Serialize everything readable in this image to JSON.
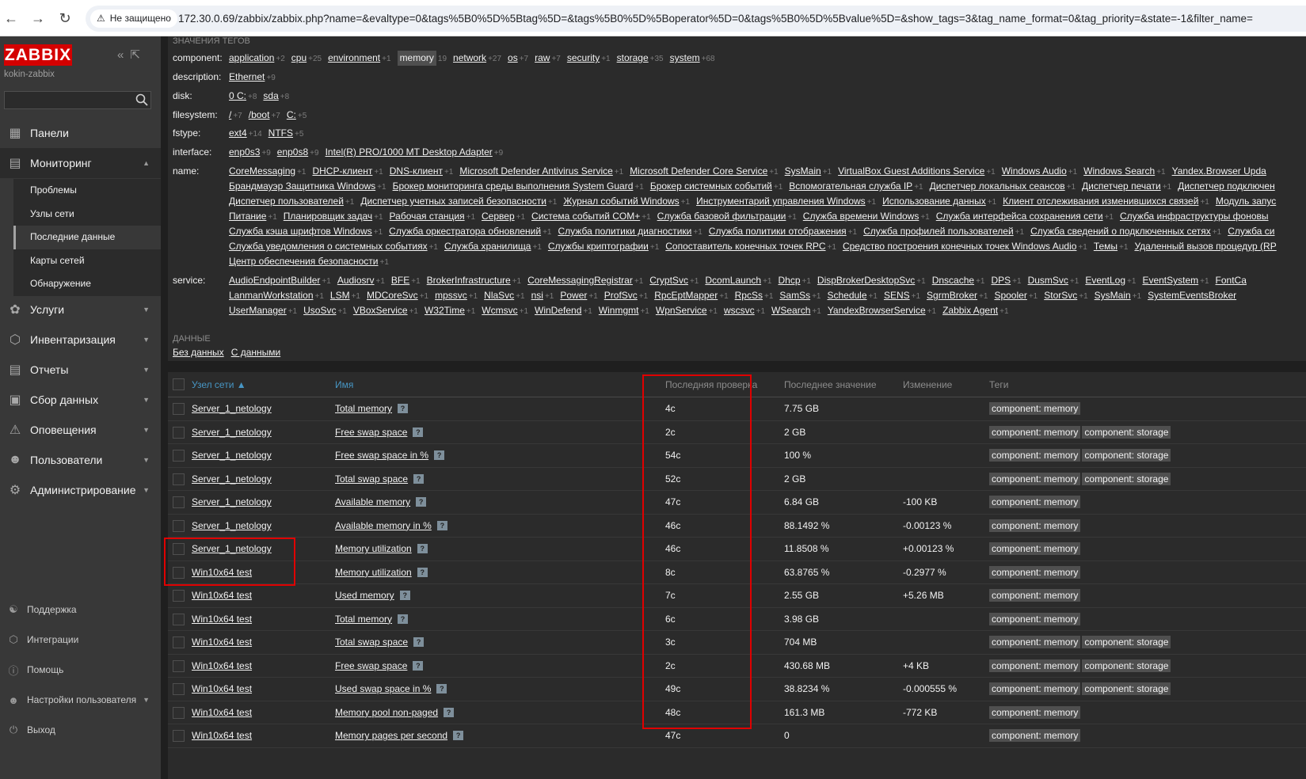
{
  "browser": {
    "security_label": "Не защищено",
    "url": "172.30.0.69/zabbix/zabbix.php?name=&evaltype=0&tags%5B0%5D%5Btag%5D=&tags%5B0%5D%5Boperator%5D=0&tags%5B0%5D%5Bvalue%5D=&show_tags=3&tag_name_format=0&tag_priority=&state=-1&filter_name="
  },
  "sidebar": {
    "logo": "ZABBIX",
    "server_name": "kokin-zabbix",
    "menu": [
      {
        "label": "Панели",
        "icon": "dashboard-icon"
      },
      {
        "label": "Мониторинг",
        "icon": "monitoring-icon",
        "expanded": true
      },
      {
        "label": "Услуги",
        "icon": "services-icon"
      },
      {
        "label": "Инвентаризация",
        "icon": "inventory-icon"
      },
      {
        "label": "Отчеты",
        "icon": "reports-icon"
      },
      {
        "label": "Сбор данных",
        "icon": "data-collection-icon"
      },
      {
        "label": "Оповещения",
        "icon": "alerts-icon"
      },
      {
        "label": "Пользователи",
        "icon": "users-icon"
      },
      {
        "label": "Администрирование",
        "icon": "administration-icon"
      }
    ],
    "submenu": [
      "Проблемы",
      "Узлы сети",
      "Последние данные",
      "Карты сетей",
      "Обнаружение"
    ],
    "active_submenu": "Последние данные",
    "footer": [
      {
        "label": "Поддержка",
        "icon": "support-icon"
      },
      {
        "label": "Интеграции",
        "icon": "integrations-icon"
      },
      {
        "label": "Помощь",
        "icon": "help-icon"
      },
      {
        "label": "Настройки пользователя",
        "icon": "user-settings-icon"
      },
      {
        "label": "Выход",
        "icon": "signout-icon"
      }
    ]
  },
  "filter": {
    "tag_values_title": "ЗНАЧЕНИЯ ТЕГОВ",
    "tags": [
      {
        "key": "component:",
        "lines": [
          [
            [
              "application",
              "+2"
            ],
            [
              "cpu",
              "+25"
            ],
            [
              "environment",
              "+1"
            ],
            [
              "memory",
              "19",
              true
            ],
            [
              "network",
              "+27"
            ],
            [
              "os",
              "+7"
            ],
            [
              "raw",
              "+7"
            ],
            [
              "security",
              "+1"
            ],
            [
              "storage",
              "+35"
            ],
            [
              "system",
              "+68"
            ]
          ]
        ]
      },
      {
        "key": "description:",
        "lines": [
          [
            [
              "Ethernet",
              "+9"
            ]
          ]
        ]
      },
      {
        "key": "disk:",
        "lines": [
          [
            [
              "0 C:",
              "+8"
            ],
            [
              "sda",
              "+8"
            ]
          ]
        ]
      },
      {
        "key": "filesystem:",
        "lines": [
          [
            [
              "/",
              "+7"
            ],
            [
              "/boot",
              "+7"
            ],
            [
              "C:",
              "+5"
            ]
          ]
        ]
      },
      {
        "key": "fstype:",
        "lines": [
          [
            [
              "ext4",
              "+14"
            ],
            [
              "NTFS",
              "+5"
            ]
          ]
        ]
      },
      {
        "key": "interface:",
        "lines": [
          [
            [
              "enp0s3",
              "+9"
            ],
            [
              "enp0s8",
              "+9"
            ],
            [
              "Intel(R) PRO/1000 MT Desktop Adapter",
              "+9"
            ]
          ]
        ]
      },
      {
        "key": "name:",
        "lines": [
          [
            [
              "CoreMessaging",
              "+1"
            ],
            [
              "DHCP-клиент",
              "+1"
            ],
            [
              "DNS-клиент",
              "+1"
            ],
            [
              "Microsoft Defender Antivirus Service",
              "+1"
            ],
            [
              "Microsoft Defender Core Service",
              "+1"
            ],
            [
              "SysMain",
              "+1"
            ],
            [
              "VirtualBox Guest Additions Service",
              "+1"
            ],
            [
              "Windows Audio",
              "+1"
            ],
            [
              "Windows Search",
              "+1"
            ],
            [
              "Yandex.Browser Upda",
              ""
            ]
          ],
          [
            [
              "Брандмауэр Защитника Windows",
              "+1"
            ],
            [
              "Брокер мониторинга среды выполнения System Guard",
              "+1"
            ],
            [
              "Брокер системных событий",
              "+1"
            ],
            [
              "Вспомогательная служба IP",
              "+1"
            ],
            [
              "Диспетчер локальных сеансов",
              "+1"
            ],
            [
              "Диспетчер печати",
              "+1"
            ],
            [
              "Диспетчер подключен",
              ""
            ]
          ],
          [
            [
              "Диспетчер пользователей",
              "+1"
            ],
            [
              "Диспетчер учетных записей безопасности",
              "+1"
            ],
            [
              "Журнал событий Windows",
              "+1"
            ],
            [
              "Инструментарий управления Windows",
              "+1"
            ],
            [
              "Использование данных",
              "+1"
            ],
            [
              "Клиент отслеживания изменившихся связей",
              "+1"
            ],
            [
              "Модуль запус",
              ""
            ]
          ],
          [
            [
              "Питание",
              "+1"
            ],
            [
              "Планировщик задач",
              "+1"
            ],
            [
              "Рабочая станция",
              "+1"
            ],
            [
              "Сервер",
              "+1"
            ],
            [
              "Система событий COM+",
              "+1"
            ],
            [
              "Служба базовой фильтрации",
              "+1"
            ],
            [
              "Служба времени Windows",
              "+1"
            ],
            [
              "Служба интерфейса сохранения сети",
              "+1"
            ],
            [
              "Служба инфраструктуры фоновы",
              ""
            ]
          ],
          [
            [
              "Служба кэша шрифтов Windows",
              "+1"
            ],
            [
              "Служба оркестратора обновлений",
              "+1"
            ],
            [
              "Служба политики диагностики",
              "+1"
            ],
            [
              "Служба политики отображения",
              "+1"
            ],
            [
              "Служба профилей пользователей",
              "+1"
            ],
            [
              "Служба сведений о подключенных сетях",
              "+1"
            ],
            [
              "Служба си",
              ""
            ]
          ],
          [
            [
              "Служба уведомления о системных событиях",
              "+1"
            ],
            [
              "Служба хранилища",
              "+1"
            ],
            [
              "Службы криптографии",
              "+1"
            ],
            [
              "Сопоставитель конечных точек RPC",
              "+1"
            ],
            [
              "Средство построения конечных точек Windows Audio",
              "+1"
            ],
            [
              "Темы",
              "+1"
            ],
            [
              "Удаленный вызов процедур (RP",
              ""
            ]
          ],
          [
            [
              "Центр обеспечения безопасности",
              "+1"
            ]
          ]
        ]
      },
      {
        "key": "service:",
        "lines": [
          [
            [
              "AudioEndpointBuilder",
              "+1"
            ],
            [
              "Audiosrv",
              "+1"
            ],
            [
              "BFE",
              "+1"
            ],
            [
              "BrokerInfrastructure",
              "+1"
            ],
            [
              "CoreMessagingRegistrar",
              "+1"
            ],
            [
              "CryptSvc",
              "+1"
            ],
            [
              "DcomLaunch",
              "+1"
            ],
            [
              "Dhcp",
              "+1"
            ],
            [
              "DispBrokerDesktopSvc",
              "+1"
            ],
            [
              "Dnscache",
              "+1"
            ],
            [
              "DPS",
              "+1"
            ],
            [
              "DusmSvc",
              "+1"
            ],
            [
              "EventLog",
              "+1"
            ],
            [
              "EventSystem",
              "+1"
            ],
            [
              "FontCa",
              ""
            ]
          ],
          [
            [
              "LanmanWorkstation",
              "+1"
            ],
            [
              "LSM",
              "+1"
            ],
            [
              "MDCoreSvc",
              "+1"
            ],
            [
              "mpssvc",
              "+1"
            ],
            [
              "NlaSvc",
              "+1"
            ],
            [
              "nsi",
              "+1"
            ],
            [
              "Power",
              "+1"
            ],
            [
              "ProfSvc",
              "+1"
            ],
            [
              "RpcEptMapper",
              "+1"
            ],
            [
              "RpcSs",
              "+1"
            ],
            [
              "SamSs",
              "+1"
            ],
            [
              "Schedule",
              "+1"
            ],
            [
              "SENS",
              "+1"
            ],
            [
              "SgrmBroker",
              "+1"
            ],
            [
              "Spooler",
              "+1"
            ],
            [
              "StorSvc",
              "+1"
            ],
            [
              "SysMain",
              "+1"
            ],
            [
              "SystemEventsBroker",
              ""
            ]
          ],
          [
            [
              "UserManager",
              "+1"
            ],
            [
              "UsoSvc",
              "+1"
            ],
            [
              "VBoxService",
              "+1"
            ],
            [
              "W32Time",
              "+1"
            ],
            [
              "Wcmsvc",
              "+1"
            ],
            [
              "WinDefend",
              "+1"
            ],
            [
              "Winmgmt",
              "+1"
            ],
            [
              "WpnService",
              "+1"
            ],
            [
              "wscsvc",
              "+1"
            ],
            [
              "WSearch",
              "+1"
            ],
            [
              "YandexBrowserService",
              "+1"
            ],
            [
              "Zabbix Agent",
              "+1"
            ]
          ]
        ]
      }
    ],
    "data_title": "ДАННЫЕ",
    "data_links": [
      "Без данных",
      "С данными"
    ]
  },
  "table": {
    "headers": {
      "host": "Узел сети ▲",
      "name": "Имя",
      "last_check": "Последняя проверка",
      "last_value": "Последнее значение",
      "change": "Изменение",
      "tags": "Теги"
    },
    "rows": [
      {
        "host": "Server_1_netology",
        "name": "Total memory",
        "last_check": "4с",
        "last_value": "7.75 GB",
        "change": "",
        "tags": [
          "component: memory"
        ]
      },
      {
        "host": "Server_1_netology",
        "name": "Free swap space",
        "last_check": "2с",
        "last_value": "2 GB",
        "change": "",
        "tags": [
          "component: memory",
          "component: storage"
        ]
      },
      {
        "host": "Server_1_netology",
        "name": "Free swap space in %",
        "last_check": "54с",
        "last_value": "100 %",
        "change": "",
        "tags": [
          "component: memory",
          "component: storage"
        ]
      },
      {
        "host": "Server_1_netology",
        "name": "Total swap space",
        "last_check": "52с",
        "last_value": "2 GB",
        "change": "",
        "tags": [
          "component: memory",
          "component: storage"
        ]
      },
      {
        "host": "Server_1_netology",
        "name": "Available memory",
        "last_check": "47с",
        "last_value": "6.84 GB",
        "change": "-100 KB",
        "tags": [
          "component: memory"
        ]
      },
      {
        "host": "Server_1_netology",
        "name": "Available memory in %",
        "last_check": "46с",
        "last_value": "88.1492 %",
        "change": "-0.00123 %",
        "tags": [
          "component: memory"
        ]
      },
      {
        "host": "Server_1_netology",
        "name": "Memory utilization",
        "last_check": "46с",
        "last_value": "11.8508 %",
        "change": "+0.00123 %",
        "tags": [
          "component: memory"
        ]
      },
      {
        "host": "Win10x64 test",
        "name": "Memory utilization",
        "last_check": "8с",
        "last_value": "63.8765 %",
        "change": "-0.2977 %",
        "tags": [
          "component: memory"
        ]
      },
      {
        "host": "Win10x64 test",
        "name": "Used memory",
        "last_check": "7с",
        "last_value": "2.55 GB",
        "change": "+5.26 MB",
        "tags": [
          "component: memory"
        ]
      },
      {
        "host": "Win10x64 test",
        "name": "Total memory",
        "last_check": "6с",
        "last_value": "3.98 GB",
        "change": "",
        "tags": [
          "component: memory"
        ]
      },
      {
        "host": "Win10x64 test",
        "name": "Total swap space",
        "last_check": "3с",
        "last_value": "704 MB",
        "change": "",
        "tags": [
          "component: memory",
          "component: storage"
        ]
      },
      {
        "host": "Win10x64 test",
        "name": "Free swap space",
        "last_check": "2с",
        "last_value": "430.68 MB",
        "change": "+4 KB",
        "tags": [
          "component: memory",
          "component: storage"
        ]
      },
      {
        "host": "Win10x64 test",
        "name": "Used swap space in %",
        "last_check": "49с",
        "last_value": "38.8234 %",
        "change": "-0.000555 %",
        "tags": [
          "component: memory",
          "component: storage"
        ]
      },
      {
        "host": "Win10x64 test",
        "name": "Memory pool non-paged",
        "last_check": "48с",
        "last_value": "161.3 MB",
        "change": "-772 KB",
        "tags": [
          "component: memory"
        ]
      },
      {
        "host": "Win10x64 test",
        "name": "Memory pages per second",
        "last_check": "47с",
        "last_value": "0",
        "change": "",
        "tags": [
          "component: memory"
        ]
      }
    ]
  },
  "colors": {
    "annotation": "#e00000",
    "link": "#4796c4",
    "brand": "#d40000"
  }
}
